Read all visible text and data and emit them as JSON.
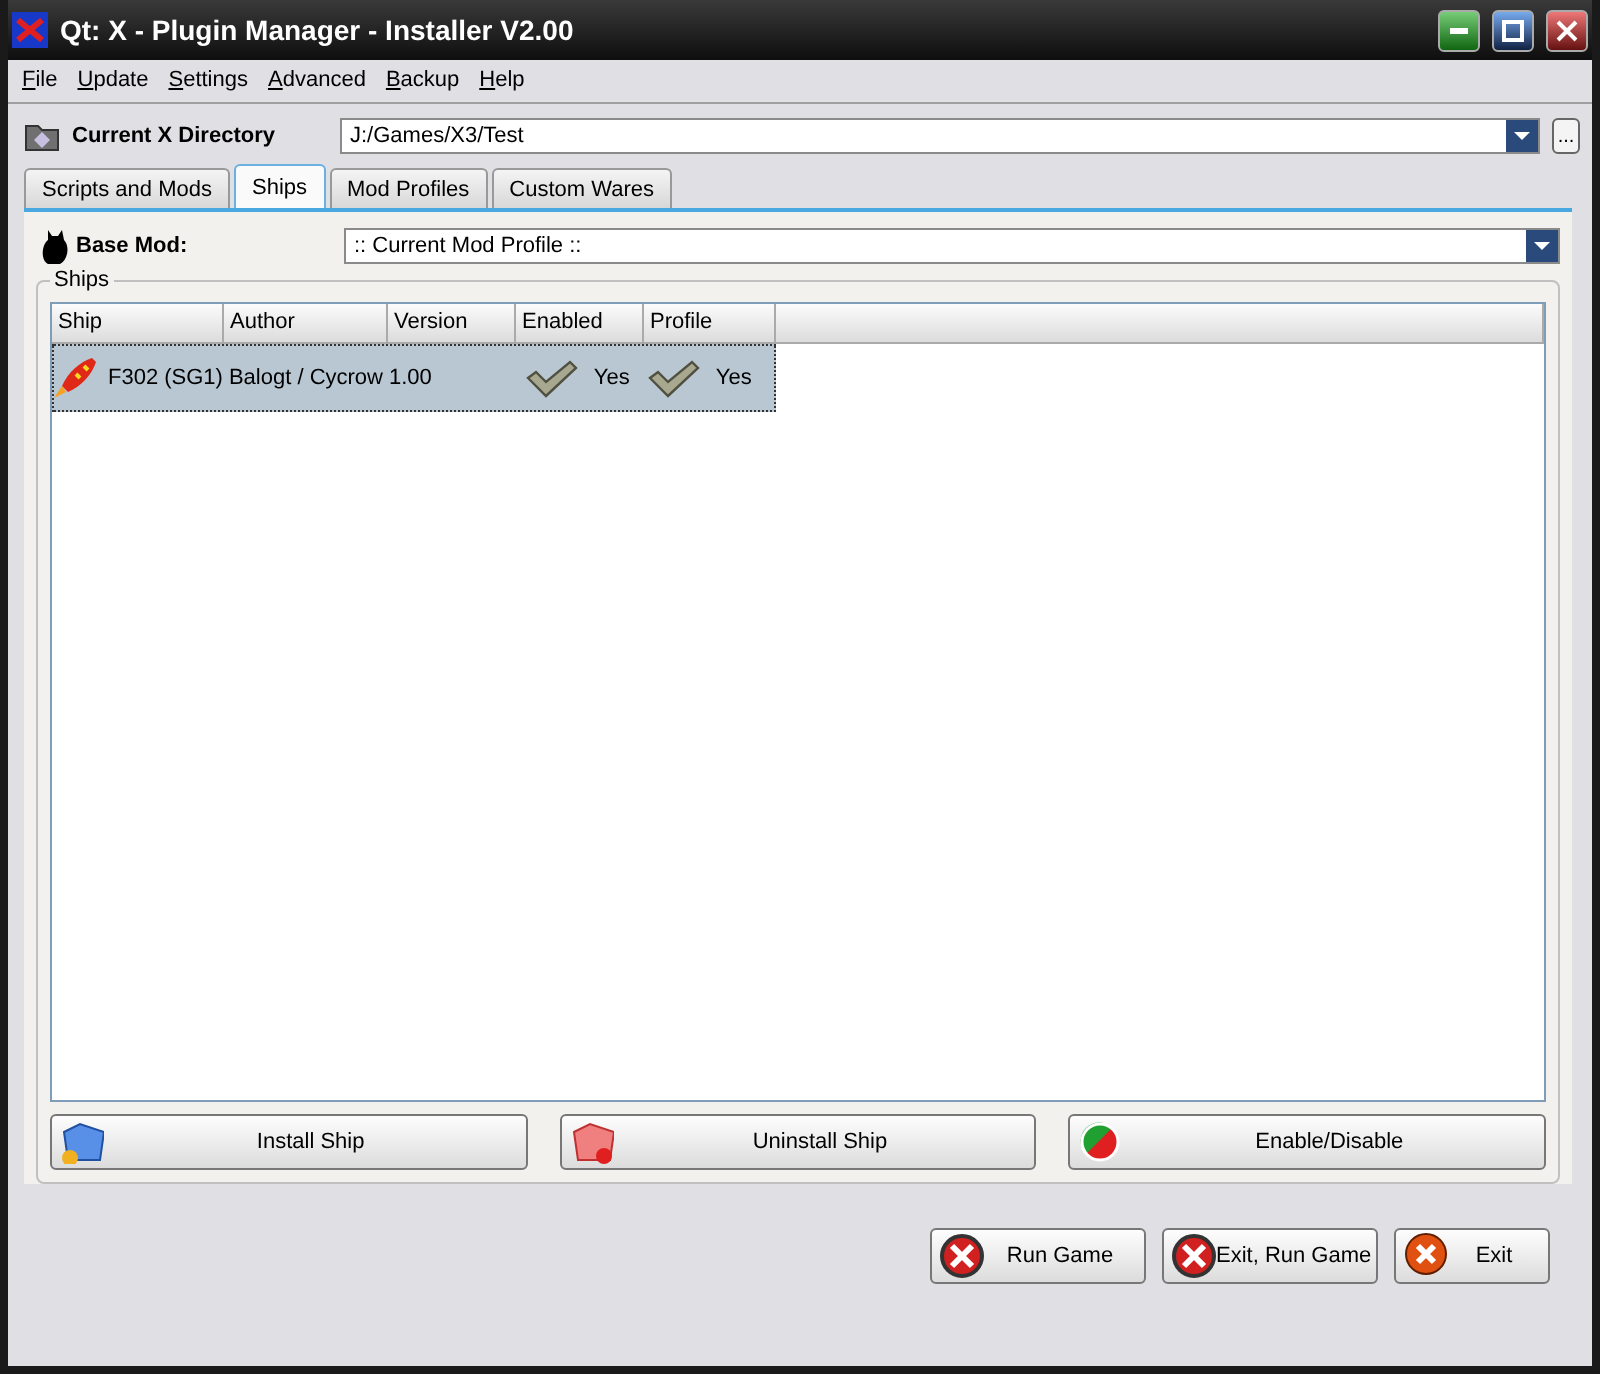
{
  "window": {
    "title": "Qt: X - Plugin Manager - Installer V2.00"
  },
  "menu": [
    "File",
    "Update",
    "Settings",
    "Advanced",
    "Backup",
    "Help"
  ],
  "directory": {
    "label": "Current X Directory",
    "value": "J:/Games/X3/Test",
    "browse": "..."
  },
  "tabs": [
    {
      "label": "Scripts and Mods",
      "selected": false
    },
    {
      "label": "Ships",
      "selected": true
    },
    {
      "label": "Mod Profiles",
      "selected": false
    },
    {
      "label": "Custom Wares",
      "selected": false
    }
  ],
  "base_mod": {
    "label": "Base Mod:",
    "value": ":: Current Mod Profile ::"
  },
  "ships": {
    "title": "Ships",
    "columns": [
      "Ship",
      "Author",
      "Version",
      "Enabled",
      "Profile"
    ],
    "rows": [
      {
        "ship": "F302 (SG1)",
        "author": "Balogt / Cycrow",
        "version": "1.00",
        "enabled": "Yes",
        "profile": "Yes",
        "selected": true
      }
    ]
  },
  "actions": [
    {
      "kind": "install",
      "label": "Install Ship"
    },
    {
      "kind": "uninstall",
      "label": "Uninstall Ship"
    },
    {
      "kind": "toggle",
      "label": "Enable/Disable"
    }
  ],
  "footer_buttons": [
    {
      "kind": "run",
      "label": "Run Game"
    },
    {
      "kind": "run",
      "label": "Exit, Run Game"
    },
    {
      "kind": "exit",
      "label": "Exit"
    }
  ]
}
